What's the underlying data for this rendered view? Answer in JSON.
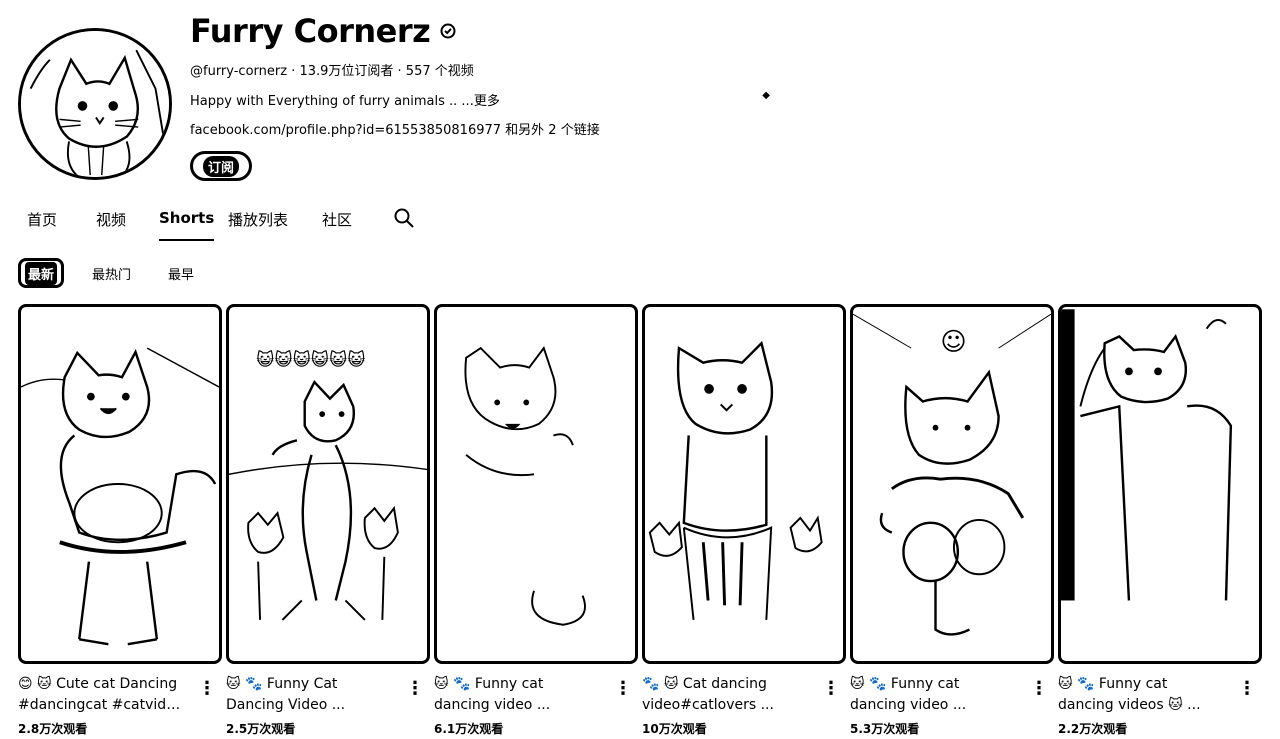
{
  "channel": {
    "name": "Furry Cornerz",
    "verified_icon": "check-circle-icon",
    "handle_meta": "@furry-cornerz · 13.9万位订阅者 · 557 个视频",
    "description": "Happy with Everything of furry animals .. ...更多",
    "description_toggle_icon": "unfold-icon",
    "links": "facebook.com/profile.php?id=61553850816977 和另外 2 个链接",
    "subscribe_label": "订阅"
  },
  "tabs": [
    {
      "label": "首页"
    },
    {
      "label": "视频"
    },
    {
      "label": "Shorts",
      "active": true
    },
    {
      "label": "播放列表"
    },
    {
      "label": "社区"
    }
  ],
  "tab_search_icon": "search-icon",
  "chips": [
    {
      "label": "最新",
      "active": true
    },
    {
      "label": "最热门"
    },
    {
      "label": "最早"
    }
  ],
  "shorts": [
    {
      "title_line1": "😊 🐱 Cute cat Dancing",
      "title_line2": "#dancingcat #catvide...",
      "views": "2.8万次观看"
    },
    {
      "title_line1": "🐱 🐾 Funny Cat",
      "title_line2": "Dancing Video ...",
      "views": "2.5万次观看"
    },
    {
      "title_line1": "🐱 🐾 Funny cat",
      "title_line2": "dancing video ...",
      "views": "6.1万次观看"
    },
    {
      "title_line1": "🐾 🐱 Cat dancing",
      "title_line2": "video#catlovers ...",
      "views": "10万次观看"
    },
    {
      "title_line1": "🐱 🐾 Funny cat",
      "title_line2": "dancing video ...",
      "views": "5.3万次观看"
    },
    {
      "title_line1": "🐱 🐾 Funny cat",
      "title_line2": "dancing videos 🐱 ...",
      "views": "2.2万次观看"
    }
  ],
  "thumb2_overlay": "😺😺😺😺😺😺",
  "thumb5_overlay": "☺",
  "more_icon": "more-vertical-icon"
}
